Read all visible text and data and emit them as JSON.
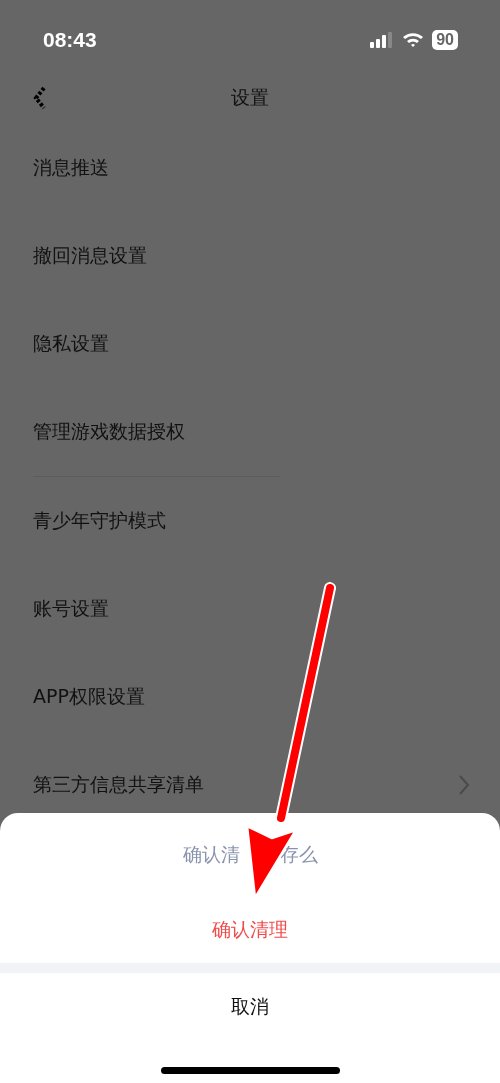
{
  "status_bar": {
    "time": "08:43",
    "battery": "90"
  },
  "nav": {
    "title": "设置"
  },
  "sections": [
    {
      "items": [
        {
          "label": "消息推送",
          "chevron": false
        },
        {
          "label": "撤回消息设置",
          "chevron": false
        },
        {
          "label": "隐私设置",
          "chevron": false
        },
        {
          "label": "管理游戏数据授权",
          "chevron": false
        }
      ]
    },
    {
      "items": [
        {
          "label": "青少年守护模式",
          "chevron": false
        },
        {
          "label": "账号设置",
          "chevron": false
        },
        {
          "label": "APP权限设置",
          "chevron": false
        },
        {
          "label": "第三方信息共享清单",
          "chevron": true
        }
      ]
    }
  ],
  "action_sheet": {
    "title_parts": [
      "确认清",
      "存么"
    ],
    "actions": [
      {
        "label": "确认清理",
        "kind": "destructive"
      }
    ],
    "cancel": "取消"
  }
}
